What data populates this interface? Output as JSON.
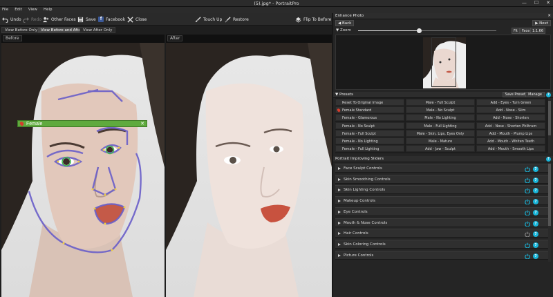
{
  "window": {
    "title": "(5).jpg* - PortraitPro",
    "controls": [
      "—",
      "☐",
      "✕"
    ]
  },
  "menu": [
    "File",
    "Edit",
    "View",
    "Help"
  ],
  "toolbar": {
    "undo": "Undo",
    "redo": "Redo",
    "other_faces": "Other Faces",
    "save": "Save",
    "facebook": "Facebook",
    "close": "Close",
    "touch_up": "Touch Up",
    "restore": "Restore",
    "flip": "Flip To Before"
  },
  "view_tabs": [
    "View Before Only",
    "View Before and After",
    "View After Only"
  ],
  "active_view_tab": 1,
  "panels": {
    "before": "Before",
    "after": "After"
  },
  "face_tag": {
    "label": "Female",
    "close": "✕"
  },
  "enhance": {
    "title": "Enhance Photo",
    "back": "Back",
    "next": "Next",
    "zoom_label": "Zoom",
    "zoom_value": 0.44,
    "fit": "Fit",
    "face": "Face",
    "ratio": "1:1.66"
  },
  "presets": {
    "title": "Presets",
    "save": "Save Preset",
    "manage": "Manage",
    "columns": [
      [
        "Reset To Original Image",
        "Female Standard",
        "Female - Glamorous",
        "Female - No Sculpt",
        "Female - Full Sculpt",
        "Female - No Lighting",
        "Female - Full Lighting"
      ],
      [
        "Male - Full Sculpt",
        "Male - No Sculpt",
        "Male - No Lighting",
        "Male - Full Lighting",
        "Male - Skin, Lips, Eyes Only",
        "Male - Mature",
        "Add - Jaw - Sculpt"
      ],
      [
        "Add - Eyes - Turn Green",
        "Add - Nose - Slim",
        "Add - Nose - Shorten",
        "Add - Nose - Shorten Philtrum",
        "Add - Mouth - Plump Lips",
        "Add - Mouth - Whiten Teeth",
        "Add - Mouth - Smooth Lips"
      ]
    ]
  },
  "sliders": {
    "title": "Portrait Improving Sliders",
    "items": [
      {
        "label": "Face Sculpt Controls",
        "active": true
      },
      {
        "label": "Skin Smoothing Controls",
        "active": true
      },
      {
        "label": "Skin Lighting Controls",
        "active": true
      },
      {
        "label": "Makeup Controls",
        "active": true
      },
      {
        "label": "Eye Controls",
        "active": true
      },
      {
        "label": "Mouth & Nose Controls",
        "active": true
      },
      {
        "label": "Hair Controls",
        "active": false
      },
      {
        "label": "Skin Coloring Controls",
        "active": true
      },
      {
        "label": "Picture Controls",
        "active": true
      }
    ]
  },
  "colors": {
    "accent": "#18b4d8",
    "face_tag": "#5faa3e",
    "outline": "#6a5fc9",
    "pin": "#d63c2c"
  }
}
